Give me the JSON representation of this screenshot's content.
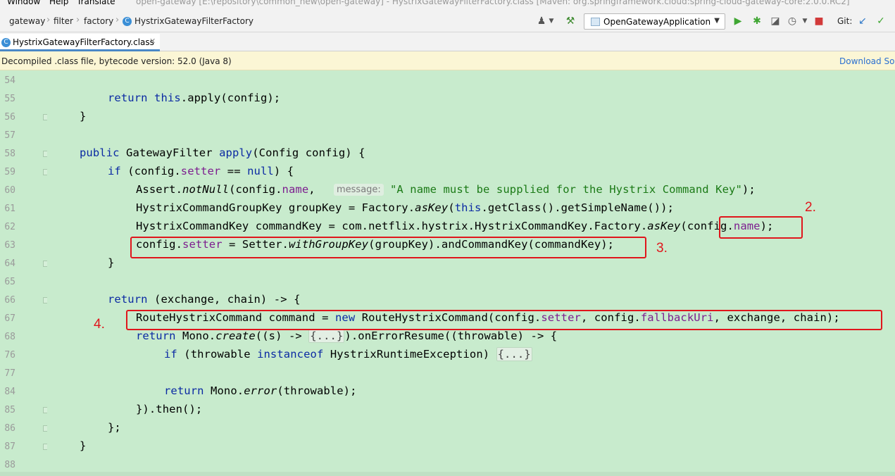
{
  "menubar": {
    "items": [
      "Window",
      "Help",
      "Translate"
    ],
    "window_title": "open-gateway [E:\\repository\\common_new\\open-gateway] - HystrixGatewayFilterFactory.class [Maven: org.springframework.cloud:spring-cloud-gateway-core:2.0.0.RC2]"
  },
  "breadcrumb": [
    "gateway",
    "filter",
    "factory",
    "HystrixGatewayFilterFactory"
  ],
  "toolbar": {
    "run_config": "OpenGatewayApplication",
    "git_label": "Git:"
  },
  "tabs": [
    {
      "label": "HystrixGatewayFilterFactory.class"
    }
  ],
  "notice": {
    "text": "Decompiled .class file, bytecode version: 52.0 (Java 8)",
    "link": "Download So"
  },
  "editor": {
    "line_numbers": [
      "54",
      "55",
      "56",
      "57",
      "58",
      "59",
      "60",
      "61",
      "62",
      "63",
      "64",
      "65",
      "66",
      "67",
      "68",
      "76",
      "77",
      "84",
      "85",
      "86",
      "87",
      "88"
    ],
    "param_hint": "message:",
    "annotations": [
      "2.",
      "3.",
      "4."
    ]
  },
  "colors": {
    "editor_bg": "#c8ebcd",
    "keyword": "#0b2aa3",
    "field": "#7d1e8f",
    "string": "#1b7a16",
    "annotation_red": "#e0161c"
  }
}
